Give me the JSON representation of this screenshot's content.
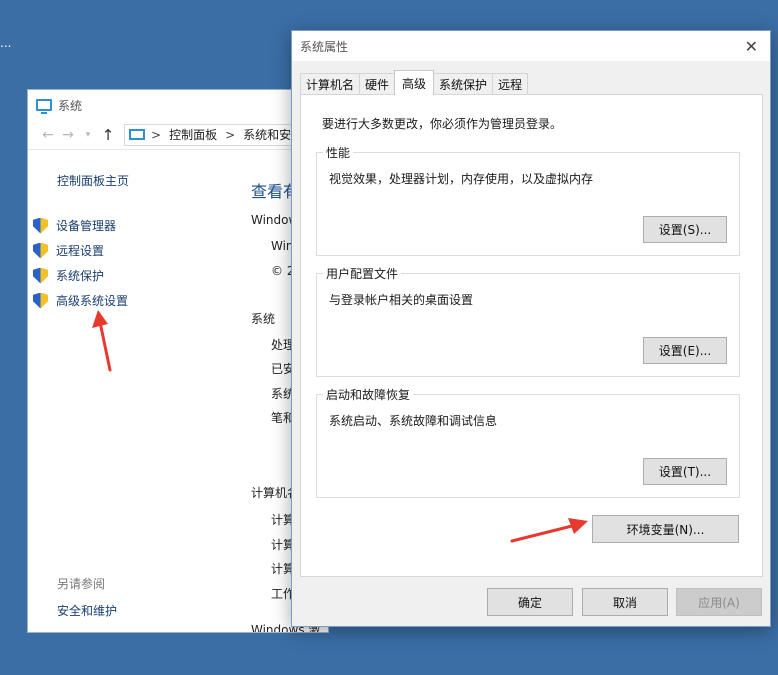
{
  "desktop": {
    "edge_text": "..."
  },
  "system_window": {
    "title": "系统",
    "address": {
      "part1": "控制面板",
      "separator": ">",
      "part2": "系统和安"
    },
    "sidebar": {
      "home": "控制面板主页",
      "items": [
        {
          "label": "设备管理器",
          "icon": "uac-shield-icon"
        },
        {
          "label": "远程设置",
          "icon": "uac-shield-icon"
        },
        {
          "label": "系统保护",
          "icon": "uac-shield-icon"
        },
        {
          "label": "高级系统设置",
          "icon": "uac-shield-icon"
        }
      ],
      "see_also": "另请参阅",
      "security_link": "安全和维护"
    },
    "main": {
      "title": "查看有",
      "windows_label": "Window",
      "edition": "Win",
      "copyright": "© 2",
      "system_heading": "系统",
      "system_rows": [
        "处理",
        "已安",
        "系统",
        "笔和"
      ],
      "computer_heading": "计算机名",
      "computer_rows": [
        "计算",
        "计算",
        "计算",
        "工作"
      ],
      "activation": "Windows 激活"
    }
  },
  "dialog": {
    "title": "系统属性",
    "close_glyph": "✕",
    "tabs": [
      "计算机名",
      "硬件",
      "高级",
      "系统保护",
      "远程"
    ],
    "active_tab": "高级",
    "admin_note": "要进行大多数更改，你必须作为管理员登录。",
    "groups": [
      {
        "label": "性能",
        "desc": "视觉效果，处理器计划，内存使用，以及虚拟内存",
        "button": "设置(S)..."
      },
      {
        "label": "用户配置文件",
        "desc": "与登录帐户相关的桌面设置",
        "button": "设置(E)..."
      },
      {
        "label": "启动和故障恢复",
        "desc": "系统启动、系统故障和调试信息",
        "button": "设置(T)..."
      }
    ],
    "env_button": "环境变量(N)...",
    "ok_button": "确定",
    "cancel_button": "取消",
    "apply_button": "应用(A)"
  },
  "colors": {
    "desktop": "#3a6ea5",
    "link": "#1a3e6e",
    "annotation_arrow": "#e8392f"
  }
}
